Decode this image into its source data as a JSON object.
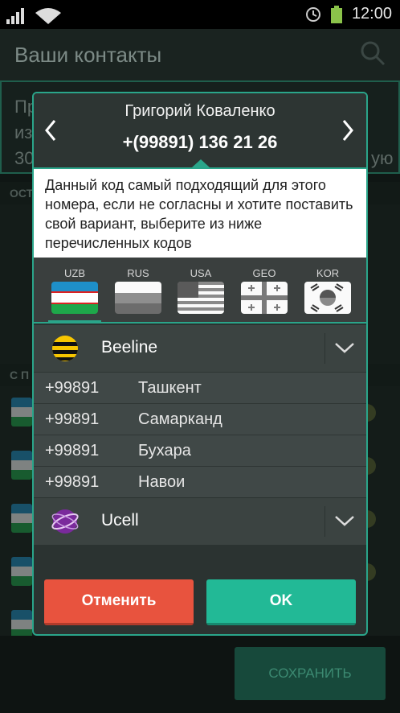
{
  "status_bar": {
    "time": "12:00"
  },
  "action_bar": {
    "title": "Ваши контакты"
  },
  "background": {
    "banner_fragments": [
      "Пр",
      "из",
      "30",
      "ую"
    ],
    "section_1": "ОСТ",
    "section_2": "С П",
    "save_button": "СОХРАНИТЬ"
  },
  "dialog": {
    "contact_name": "Григорий Коваленко",
    "contact_phone": "+(99891) 136 21 26",
    "description": "Данный код самый подходящий для этого номера, если не согласны и хотите поставить свой вариант, выберите из ниже перечисленных кодов",
    "tabs": [
      {
        "label": "UZB",
        "selected": true
      },
      {
        "label": "RUS",
        "selected": false
      },
      {
        "label": "USA",
        "selected": false
      },
      {
        "label": "GEO",
        "selected": false
      },
      {
        "label": "KOR",
        "selected": false
      }
    ],
    "operators": [
      {
        "name": "Beeline",
        "expanded": true,
        "codes": [
          {
            "code": "+99891",
            "city": "Ташкент"
          },
          {
            "code": "+99891",
            "city": "Самарканд"
          },
          {
            "code": "+99891",
            "city": "Бухара"
          },
          {
            "code": "+99891",
            "city": "Навои"
          }
        ]
      },
      {
        "name": "Ucell",
        "expanded": false,
        "codes": []
      }
    ],
    "cancel_label": "Отменить",
    "ok_label": "OK"
  },
  "colors": {
    "accent": "#2aa58a",
    "cancel": "#e8533e",
    "ok": "#22b996"
  }
}
